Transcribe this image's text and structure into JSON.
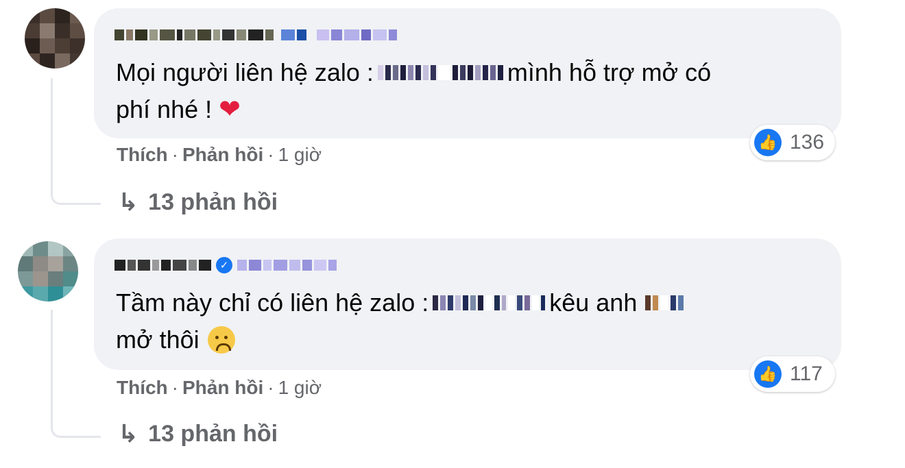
{
  "comments": [
    {
      "text_line1_before": "Mọi người liên hệ zalo :",
      "text_line1_after": "mình hỗ trợ mở có",
      "text_line2": "phí nhé !",
      "emoji_icon": "heart-emoji",
      "like_count": "136",
      "actions": {
        "like": "Thích",
        "reply": "Phản hồi",
        "time": "1 giờ",
        "dot": "·"
      },
      "replies_label": "13 phản hồi"
    },
    {
      "text_line1_before": "Tầm này chỉ có liên hệ zalo :",
      "text_line1_after": "kêu anh",
      "text_line2": "mở thôi",
      "emoji_icon": "sad-face-emoji",
      "like_count": "117",
      "actions": {
        "like": "Thích",
        "reply": "Phản hồi",
        "time": "1 giờ",
        "dot": "·"
      },
      "replies_label": "13 phản hồi"
    }
  ],
  "colors": {
    "bubble": "#f0f2f5",
    "meta_text": "#65676b",
    "like_blue": "#1877f2",
    "heart_red": "#e41e3f"
  }
}
